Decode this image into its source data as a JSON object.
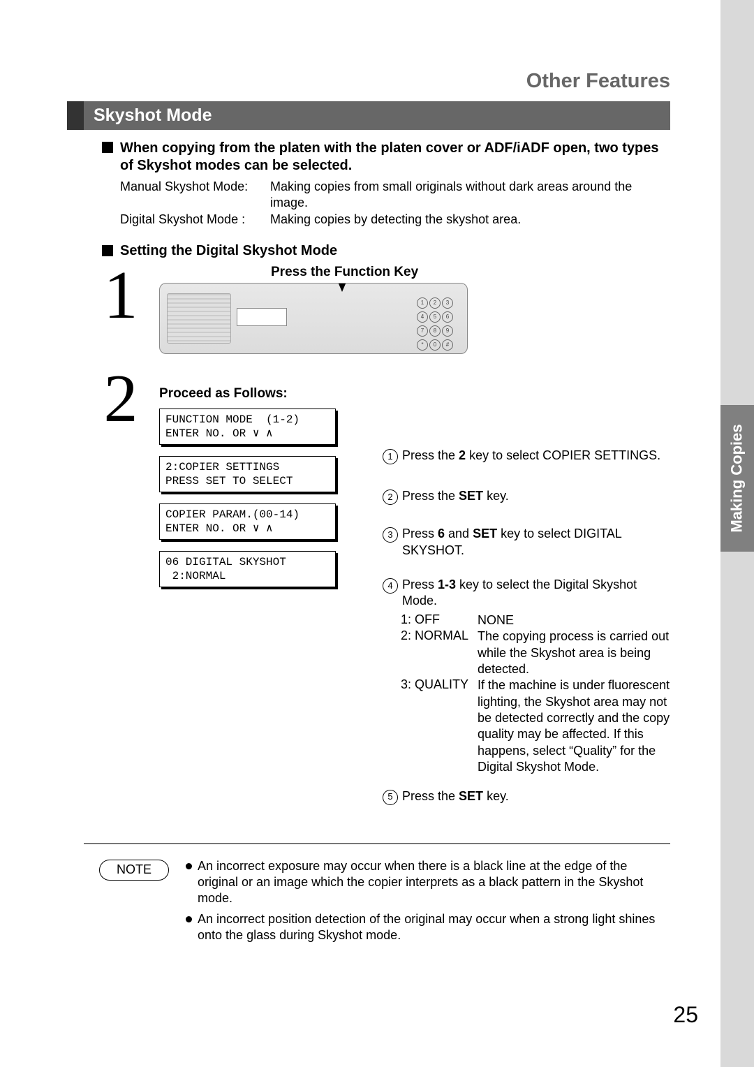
{
  "sideTab": "Making Copies",
  "pageTitle": "Other Features",
  "sectionTitle": "Skyshot Mode",
  "intro": "When copying from the platen with the platen cover or ADF/iADF open, two types of Skyshot modes can be selected.",
  "modes": [
    {
      "name": "Manual Skyshot Mode",
      "sep": ":",
      "desc": "Making copies from small originals without dark areas around the image."
    },
    {
      "name": "Digital Skyshot Mode",
      "sep": " :",
      "desc": "Making copies by detecting the skyshot area."
    }
  ],
  "subHeading": "Setting the Digital Skyshot Mode",
  "step1": {
    "num": "1",
    "label": "Press the Function Key",
    "keypad": [
      "1",
      "2",
      "3",
      "4",
      "5",
      "6",
      "7",
      "8",
      "9",
      "*",
      "0",
      "#"
    ]
  },
  "step2": {
    "num": "2",
    "title": "Proceed as Follows:",
    "lcd": [
      "FUNCTION MODE  (1-2)\nENTER NO. OR ∨ ∧",
      "2:COPIER SETTINGS\nPRESS SET TO SELECT",
      "COPIER PARAM.(00-14)\nENTER NO. OR ∨ ∧",
      "06 DIGITAL SKYSHOT\n 2:NORMAL"
    ],
    "instructions": {
      "i1": {
        "pre": "Press the ",
        "bold": "2",
        "post": " key to select COPIER SETTINGS."
      },
      "i2": {
        "pre": "Press the ",
        "bold": "SET",
        "post": " key."
      },
      "i3": {
        "pre": "Press ",
        "bold1": "6",
        "mid": " and ",
        "bold2": "SET",
        "post": " key to select DIGITAL SKYSHOT."
      },
      "i4": {
        "pre": "Press ",
        "bold": "1-3",
        "post": " key to select the Digital Skyshot Mode.",
        "options": [
          {
            "k": "1: OFF",
            "v": "NONE"
          },
          {
            "k": "2: NORMAL",
            "v": "The copying process is carried out while the Skyshot area is being detected."
          },
          {
            "k": "3: QUALITY",
            "v": "If the machine is under fluorescent lighting, the Skyshot area may not be detected correctly and the copy quality may be affected. If this happens, select “Quality” for the Digital Skyshot Mode."
          }
        ]
      },
      "i5": {
        "pre": "Press the ",
        "bold": "SET",
        "post": " key."
      }
    }
  },
  "note": {
    "label": "NOTE",
    "items": [
      "An incorrect exposure may occur when there is a black line at the edge of the original or an image which the copier interprets as a black pattern in the Skyshot mode.",
      "An incorrect position detection of the original may occur when a strong light shines onto the glass during Skyshot mode."
    ]
  },
  "pageNumber": "25"
}
